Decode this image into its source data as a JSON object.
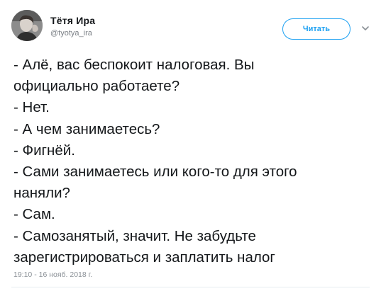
{
  "author": {
    "display_name": "Тётя Ира",
    "handle": "@tyotya_ira",
    "avatar_icon": "avatar-photo"
  },
  "follow_button": {
    "label": "Читать"
  },
  "menu_icon": "chevron-down-icon",
  "tweet": {
    "lines": [
      "- Алё, вас беспокоит налоговая. Вы",
      "официально работаете?",
      "- Нет.",
      "- А чем занимаетесь?",
      "- Фигнёй.",
      "- Сами занимаетесь или кого-то для этого",
      "наняли?",
      "- Сам.",
      "- Самозанятый, значит. Не забудьте",
      "зарегистрироваться и заплатить налог"
    ],
    "timestamp": "19:10 - 16 нояб. 2018 г."
  },
  "colors": {
    "accent": "#1da1f2",
    "text": "#14171a",
    "muted": "#7a7f85"
  }
}
